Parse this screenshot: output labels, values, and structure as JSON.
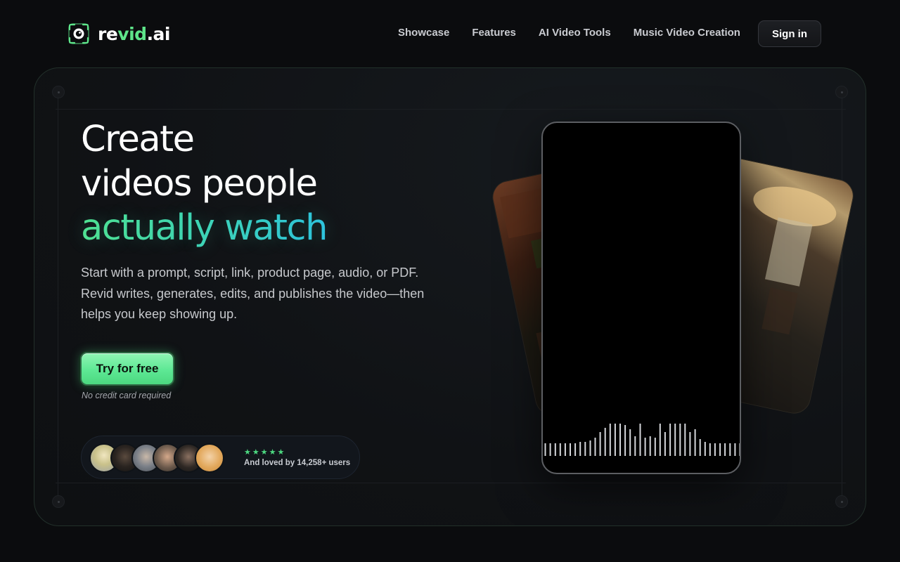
{
  "header": {
    "logo": {
      "text_main": "re",
      "text_accent": "vid",
      "text_suffix": ".ai"
    },
    "nav": [
      "Showcase",
      "Features",
      "AI Video Tools",
      "Music Video Creation"
    ],
    "signin_label": "Sign in"
  },
  "hero": {
    "headline_line1": "Create",
    "headline_line2": "videos people",
    "headline_highlight": "actually watch",
    "subtext": "Start with a prompt, script, link, product page, audio, or PDF. Revid writes, generates, edits, and publishes the video—then helps you keep showing up.",
    "cta_label": "Try for free",
    "cta_note": "No credit card required",
    "social_proof": {
      "stars": "★★★★★",
      "text": "And loved by 14,258+ users",
      "avatar_count": 6
    }
  },
  "colors": {
    "accent_green": "#5ee58a",
    "gradient_start": "#52e291",
    "gradient_end": "#2ec3e0",
    "background": "#0b0c0e"
  },
  "icons": [
    "logo-eye-icon",
    "star-icon"
  ]
}
